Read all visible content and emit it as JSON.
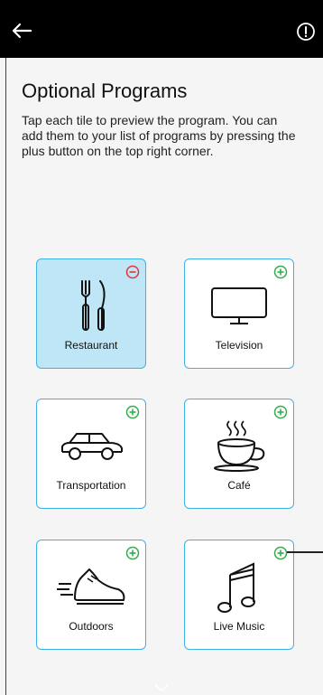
{
  "header": {
    "back_icon": "arrow-left-icon",
    "info_icon": "info-circle-icon"
  },
  "page": {
    "title": "Optional Programs",
    "description": "Tap each tile to preview the program. You can add them to your list of programs by pressing the plus button on the top right corner."
  },
  "tiles": [
    {
      "label": "Restaurant",
      "icon": "fork-knife-icon",
      "status": "remove",
      "selected": true
    },
    {
      "label": "Television",
      "icon": "television-icon",
      "status": "add",
      "selected": false
    },
    {
      "label": "Transportation",
      "icon": "car-icon",
      "status": "add",
      "selected": false
    },
    {
      "label": "Café",
      "icon": "coffee-cup-icon",
      "status": "add",
      "selected": false
    },
    {
      "label": "Outdoors",
      "icon": "running-shoe-icon",
      "status": "add",
      "selected": false
    },
    {
      "label": "Live Music",
      "icon": "music-note-icon",
      "status": "add",
      "selected": false
    }
  ],
  "colors": {
    "tile_border": "#3bb3e4",
    "tile_selected_bg": "#bfe6f6",
    "add_badge": "#2fae4a",
    "remove_badge": "#e0353a"
  }
}
